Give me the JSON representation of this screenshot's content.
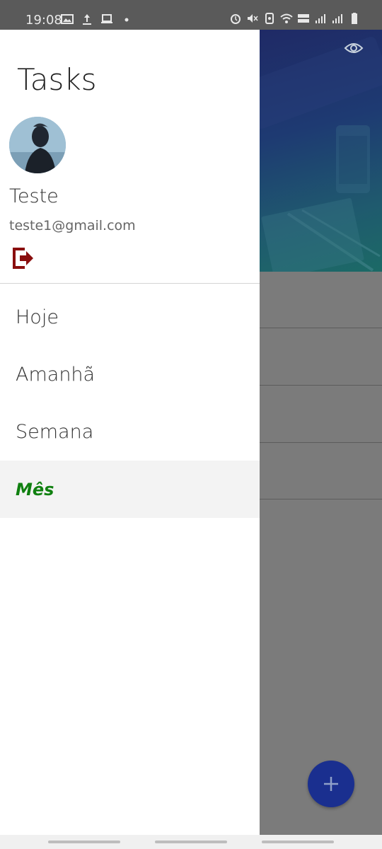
{
  "status_bar": {
    "time": "19:08"
  },
  "drawer": {
    "title": "Tasks",
    "user": {
      "name": "Teste",
      "email": "teste1@gmail.com"
    },
    "menu": [
      {
        "label": "Hoje",
        "active": false
      },
      {
        "label": "Amanhã",
        "active": false
      },
      {
        "label": "Semana",
        "active": false
      },
      {
        "label": "Mês",
        "active": true
      }
    ]
  },
  "colors": {
    "active_menu_text": "#108010",
    "logout_icon": "#8a0e0e",
    "fab": "#1a2f8f",
    "header_gradient_start": "#1f2a66",
    "header_gradient_end": "#1c6a66"
  },
  "icons": {
    "logout": "logout-icon",
    "eye": "eye-icon",
    "add": "plus-icon"
  }
}
